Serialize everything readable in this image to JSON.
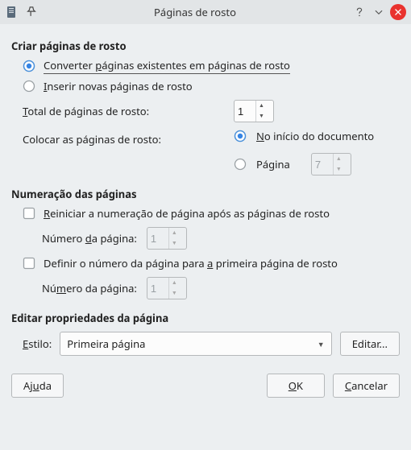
{
  "titlebar": {
    "title": "Páginas de rosto"
  },
  "sections": {
    "make": {
      "header": "Criar páginas de rosto",
      "convert": "Converter páginas existentes em páginas de rosto",
      "insert": "Inserir novas páginas de rosto",
      "total_label": "Total de páginas de rosto:",
      "total_value": "1",
      "place_label": "Colocar as páginas de rosto:",
      "place_start": "No início do documento",
      "place_page": "Página",
      "place_page_value": "7"
    },
    "numbering": {
      "header": "Numeração das páginas",
      "restart": "Reiniciar a numeração de página após as páginas de rosto",
      "restart_num_label": "Número da página:",
      "restart_num_value": "1",
      "setnum": "Definir o número da página para a primeira página de rosto",
      "setnum_num_label": "Número da página:",
      "setnum_num_value": "1"
    },
    "edit": {
      "header": "Editar propriedades da página",
      "style_label": "Estilo:",
      "style_value": "Primeira página",
      "edit_btn": "Editar..."
    }
  },
  "buttons": {
    "help": "Ajuda",
    "ok": "OK",
    "cancel": "Cancelar"
  }
}
